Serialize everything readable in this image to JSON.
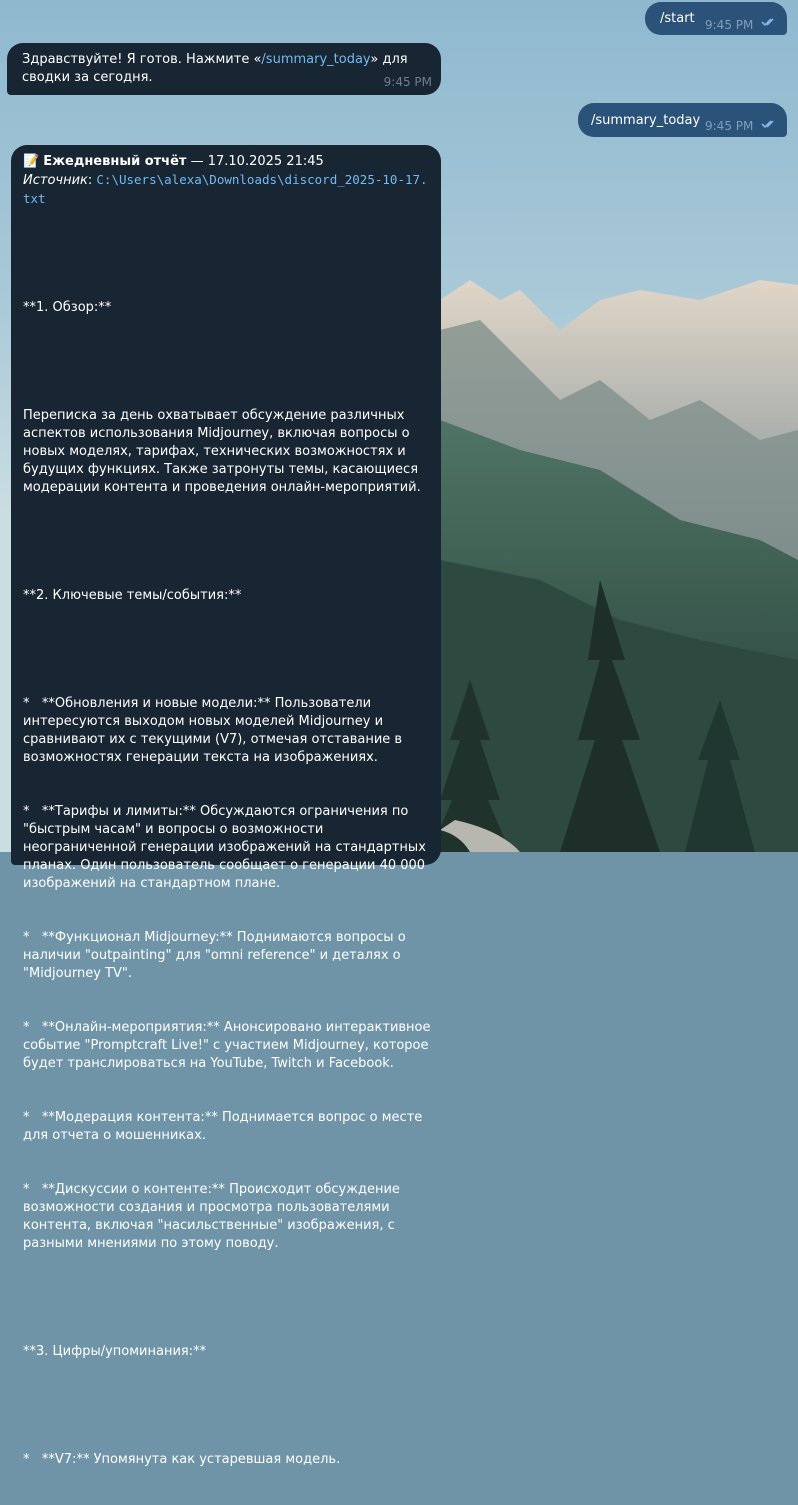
{
  "messages": {
    "start": {
      "text": "/start",
      "time": "9:45 PM"
    },
    "greeting": {
      "text_before": "Здравствуйте! Я готов. Нажмите «",
      "command": "/summary_today",
      "text_after": "» для сводки за сегодня.",
      "time": "9:45 PM"
    },
    "summary_cmd": {
      "text": "/summary_today",
      "time": "9:45 PM"
    },
    "report": {
      "emoji": "📝",
      "title": "Ежедневный отчёт",
      "date": " — 17.10.2025 21:45",
      "source_label": "Источник",
      "source_colon": ": ",
      "source_path": "C:\\Users\\alexa\\Downloads\\discord_2025-10-17.txt",
      "lines": [
        "",
        "**1. Обзор:**",
        "",
        "Переписка за день охватывает обсуждение различных аспектов использования Midjourney, включая вопросы о новых моделях, тарифах, технических возможностях и будущих функциях. Также затронуты темы, касающиеся модерации контента и проведения онлайн-мероприятий.",
        "",
        "**2. Ключевые темы/события:**",
        "",
        "*   **Обновления и новые модели:** Пользователи интересуются выходом новых моделей Midjourney и сравнивают их с текущими (V7), отмечая отставание в возможностях генерации текста на изображениях.",
        "*   **Тарифы и лимиты:** Обсуждаются ограничения по \"быстрым часам\" и вопросы о возможности неограниченной генерации изображений на стандартных планах. Один пользователь сообщает о генерации 40 000 изображений на стандартном плане.",
        "*   **Функционал Midjourney:** Поднимаются вопросы о наличии \"outpainting\" для \"omni reference\" и деталях о \"Midjourney TV\".",
        "*   **Онлайн-мероприятия:** Анонсировано интерактивное событие \"Promptcraft Live!\" с участием Midjourney, которое будет транслироваться на YouTube, Twitch и Facebook.",
        "*   **Модерация контента:** Поднимается вопрос о месте для отчета о мошенниках.",
        "*   **Дискуссии о контенте:** Происходит обсуждение возможности создания и просмотра пользователями контента, включая \"насильственные\" изображения, с разными мнениями по этому поводу.",
        "",
        "**3. Цифры/упоминания:**",
        "",
        "*   **V7:** Упомянута как устаревшая модель."
      ]
    }
  },
  "colors": {
    "outgoing_bubble": "#2b5278",
    "incoming_bubble": "#182533",
    "link": "#71baf2",
    "time_in": "#6d7f8f",
    "time_out": "#7f9fbf"
  }
}
